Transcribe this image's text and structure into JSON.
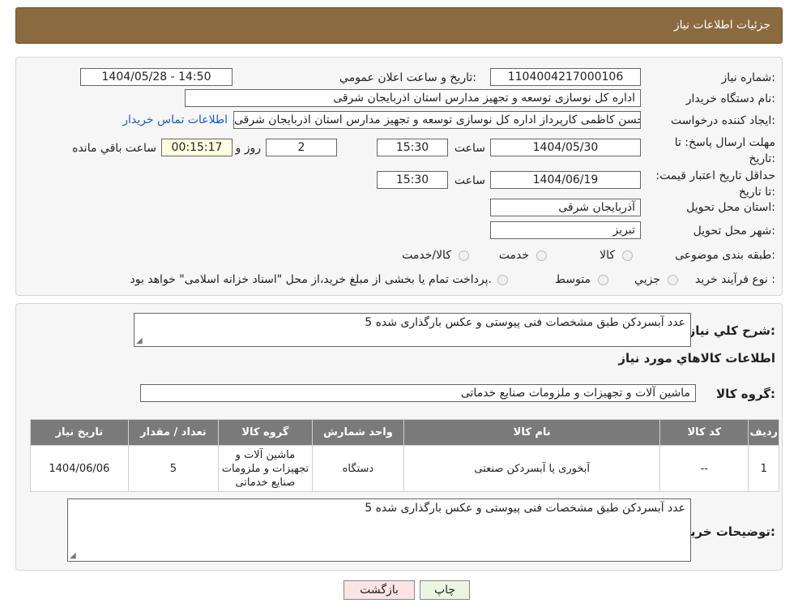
{
  "header": {
    "title": "جزئیات اطلاعات نیاز"
  },
  "form": {
    "need_number_label": "شماره نیاز:",
    "need_number": "1104004217000106",
    "announce_label": "تاریخ و ساعت اعلان عمومي:",
    "announce_value": "1404/05/28 - 14:50",
    "buyer_org_label": "نام دستگاه خريدار:",
    "buyer_org": "اداره کل نوسازی  توسعه و تجهیز مدارس استان اذربایجان شرقی",
    "creator_label": "ايجاد کننده درخواست:",
    "creator": "سید حسن کاظمی کارپرداز اداره کل نوسازی  توسعه و تجهیز مدارس استان اذربایجان شرقی",
    "contact_link": "اطلاعات تماس خريدار",
    "deadline_label": "مهلت ارسال پاسخ: تا تاریخ:",
    "deadline_date": "1404/05/30",
    "time_label": "ساعت",
    "deadline_time": "15:30",
    "days_value": "2",
    "days_label": "روز و",
    "remaining_time": "00:15:17",
    "remaining_label": "ساعت باقي مانده",
    "price_validity_label": "حداقل تاریخ اعتبار قیمت: تا تاریخ:",
    "price_validity_date": "1404/06/19",
    "price_validity_time": "15:30",
    "province_label": "استان محل تحویل:",
    "province": "آذربایجان شرقی",
    "city_label": "شهر محل تحویل:",
    "city": "تبریز",
    "category_label": "طبقه بندی موضوعی:",
    "category_options": [
      "کالا",
      "خدمت",
      "کالا/خدمت"
    ],
    "process_label": "نوع فرآيند خريد :",
    "process_options": [
      "جزيي",
      "متوسط"
    ],
    "process_note": "پرداخت تمام یا بخشی از مبلغ خرید،از محل \"اسناد خزانه اسلامی\" خواهد بود."
  },
  "description": {
    "label": "شرح کلي نياز:",
    "text": "5 عدد آبسردکن طبق مشخصات فنی پیوستی و عکس بارگذاری شده"
  },
  "goods": {
    "section_title": "اطلاعات کالاهاي مورد نياز",
    "group_label": "گروه کالا:",
    "group_value": "ماشین آلات و تجهیزات و ملزومات صنایع خدماتی",
    "columns": [
      "رديف",
      "کد کالا",
      "نام کالا",
      "واحد شمارش",
      "گروه کالا",
      "تعداد / مقدار",
      "تاريخ نياز"
    ],
    "rows": [
      {
        "index": "1",
        "code": "--",
        "name": "آبخوری یا آبسردکن صنعتی",
        "unit": "دستگاه",
        "group": "ماشین آلات و تجهیزات و ملزومات صنایع خدماتی",
        "qty": "5",
        "date": "1404/06/06"
      }
    ]
  },
  "buyer_notes": {
    "label": "توضيحات خريدار:",
    "text": "5 عدد آبسردکن طبق مشخصات فنی پیوستی و عکس بارگذاری شده"
  },
  "buttons": {
    "print": "چاپ",
    "back": "بازگشت"
  },
  "watermark": {
    "text": "AriaTender.neT"
  },
  "colors": {
    "header": "#8b6a3f",
    "link": "#1a5ac8",
    "back_button": "#fde3e3",
    "print_button": "#eaf6e0",
    "table_header": "#7a7a7a"
  }
}
